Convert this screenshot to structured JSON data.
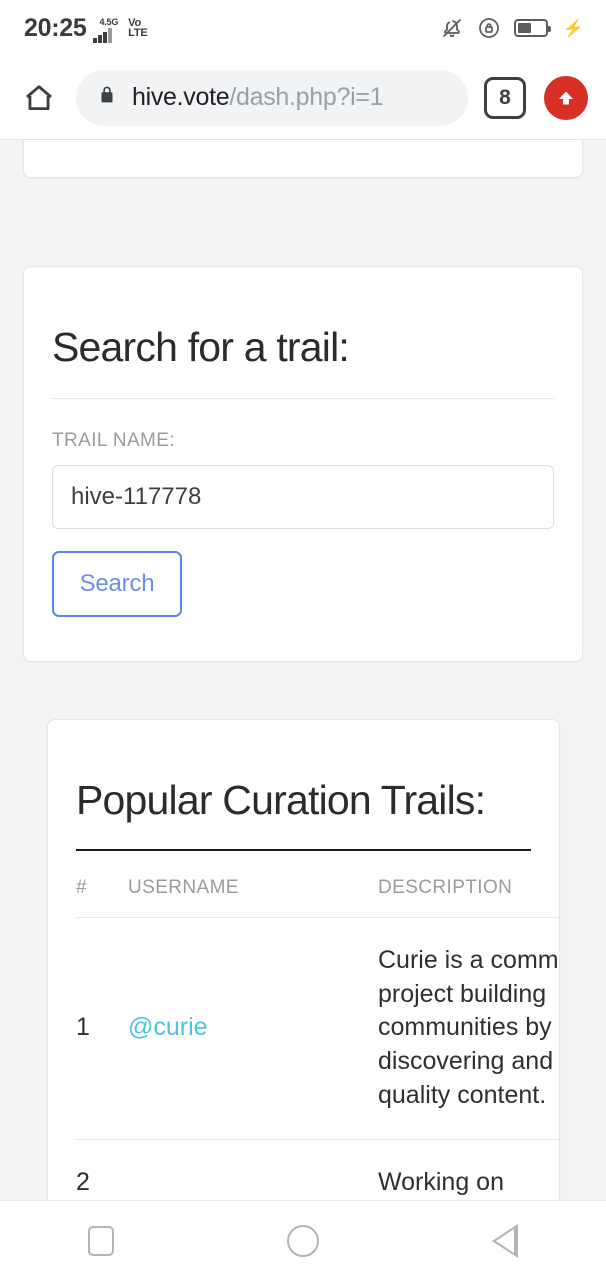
{
  "status_bar": {
    "time": "20:25",
    "network_label": "4.5G",
    "volte_line1": "Vo",
    "volte_line2": "LTE",
    "icons": [
      "bell-mute-icon",
      "rotation-lock-icon",
      "battery-charging-icon"
    ],
    "battery_percent": 52
  },
  "browser": {
    "home_icon": "home-icon",
    "lock_icon": "lock-icon",
    "url_domain": "hive.vote",
    "url_path": "/dash.php?i=1",
    "tab_count": "8",
    "menu_icon": "up-arrow-icon",
    "menu_color": "#d93025"
  },
  "search_card": {
    "title": "Search for a trail:",
    "field_label": "TRAIL NAME:",
    "input_value": "hive-117778",
    "input_placeholder": "",
    "button_label": "Search",
    "button_color": "#5b86e5"
  },
  "trails_card": {
    "title": "Popular Curation Trails:",
    "columns": [
      "#",
      "USERNAME",
      "DESCRIPTION"
    ],
    "link_color": "#4bc5dc",
    "rows": [
      {
        "num": "1",
        "username": "@curie",
        "description": "Curie is a community project building communities by discovering and rewarding quality content."
      },
      {
        "num": "2",
        "username": "",
        "description": "Working on"
      }
    ]
  },
  "nav_bar": {
    "recents_icon": "square-icon",
    "home_icon": "circle-icon",
    "back_icon": "triangle-left-icon"
  }
}
